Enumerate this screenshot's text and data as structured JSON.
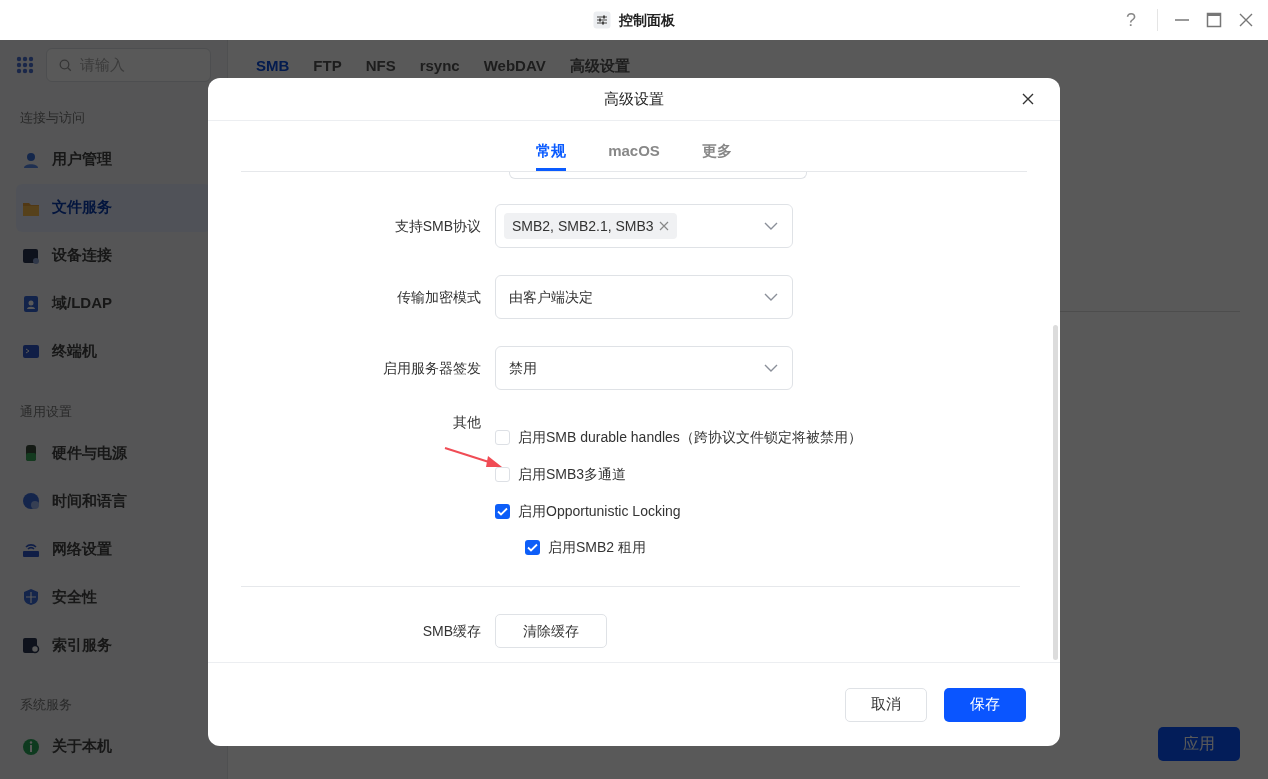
{
  "title_bar": {
    "title": "控制面板",
    "help": "?"
  },
  "sidebar": {
    "search": {
      "placeholder": "请输入"
    },
    "sections": [
      {
        "heading": "连接与访问",
        "items": [
          {
            "label": "用户管理",
            "selected": false
          },
          {
            "label": "文件服务",
            "selected": true
          },
          {
            "label": "设备连接",
            "selected": false
          },
          {
            "label": "域/LDAP",
            "selected": false
          },
          {
            "label": "终端机",
            "selected": false
          }
        ]
      },
      {
        "heading": "通用设置",
        "items": [
          {
            "label": "硬件与电源",
            "selected": false
          },
          {
            "label": "时间和语言",
            "selected": false
          },
          {
            "label": "网络设置",
            "selected": false
          },
          {
            "label": "安全性",
            "selected": false
          },
          {
            "label": "索引服务",
            "selected": false
          }
        ]
      },
      {
        "heading": "系统服务",
        "items": [
          {
            "label": "关于本机",
            "selected": false
          }
        ]
      }
    ]
  },
  "main": {
    "tabs": [
      {
        "label": "SMB",
        "selected": true
      },
      {
        "label": "FTP",
        "selected": false
      },
      {
        "label": "NFS",
        "selected": false
      },
      {
        "label": "rsync",
        "selected": false
      },
      {
        "label": "WebDAV",
        "selected": false
      },
      {
        "label": "高级设置",
        "selected": false
      }
    ],
    "apply_button": "应用"
  },
  "dialog": {
    "title": "高级设置",
    "tabs": [
      {
        "label": "常规",
        "selected": true
      },
      {
        "label": "macOS",
        "selected": false
      },
      {
        "label": "更多",
        "selected": false
      }
    ],
    "fields": [
      {
        "label": "支持SMB协议",
        "kind": "tags",
        "tags": [
          "SMB2, SMB2.1, SMB3"
        ]
      },
      {
        "label": "传输加密模式",
        "kind": "select",
        "value": "由客户端决定"
      },
      {
        "label": "启用服务器签发",
        "kind": "select",
        "value": "禁用"
      }
    ],
    "other": {
      "label": "其他",
      "options": [
        {
          "label": "启用SMB durable handles（跨协议文件锁定将被禁用）",
          "checked": false
        },
        {
          "label": "启用SMB3多通道",
          "checked": false
        },
        {
          "label": "启用Opportunistic Locking",
          "checked": true,
          "children": [
            {
              "label": "启用SMB2 租用",
              "checked": true
            }
          ]
        }
      ]
    },
    "cache": {
      "label": "SMB缓存",
      "button": "清除缓存"
    },
    "buttons": [
      {
        "label": "取消",
        "kind": "secondary"
      },
      {
        "label": "保存",
        "kind": "primary"
      }
    ]
  }
}
